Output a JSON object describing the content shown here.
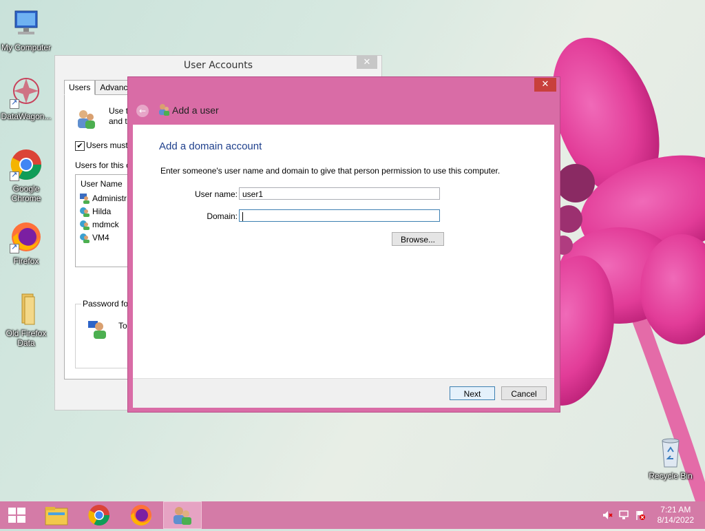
{
  "desktop": {
    "icons": [
      {
        "label": "My Computer",
        "icon": "computer-icon"
      },
      {
        "label": "DataWagon...",
        "icon": "datawagon-icon"
      },
      {
        "label": "Google Chrome",
        "icon": "chrome-icon"
      },
      {
        "label": "Firefox",
        "icon": "firefox-icon"
      },
      {
        "label": "Old Firefox Data",
        "icon": "folder-icon"
      },
      {
        "label": "Recycle Bin",
        "icon": "recycle-bin-icon"
      }
    ]
  },
  "user_accounts": {
    "title": "User Accounts",
    "close": "✕",
    "tabs": [
      "Users",
      "Advanced"
    ],
    "intro_line1": "Use th",
    "intro_line2": "and t",
    "checkbox_label": "Users must",
    "users_label": "Users for this c",
    "column_header": "User Name",
    "users": [
      "Administr",
      "Hilda",
      "mdmck",
      "VM4"
    ],
    "password_group": "Password for",
    "password_text": "To"
  },
  "dialog": {
    "title": "Add a user",
    "close": "✕",
    "back": "←",
    "heading": "Add a domain account",
    "instruction": "Enter someone's user name and domain to give that person permission to use this computer.",
    "username_label": "User name:",
    "username_value": "user1",
    "domain_label": "Domain:",
    "domain_value": "",
    "browse_label": "Browse...",
    "next_label": "Next",
    "cancel_label": "Cancel"
  },
  "taskbar": {
    "items": [
      "start-icon",
      "file-explorer-icon",
      "chrome-icon",
      "firefox-icon",
      "user-accounts-icon"
    ],
    "time": "7:21 AM",
    "date": "8/14/2022"
  },
  "colors": {
    "accent": "#d96ca6",
    "taskbar": "#d47ba7",
    "heading": "#1e3f8c"
  }
}
